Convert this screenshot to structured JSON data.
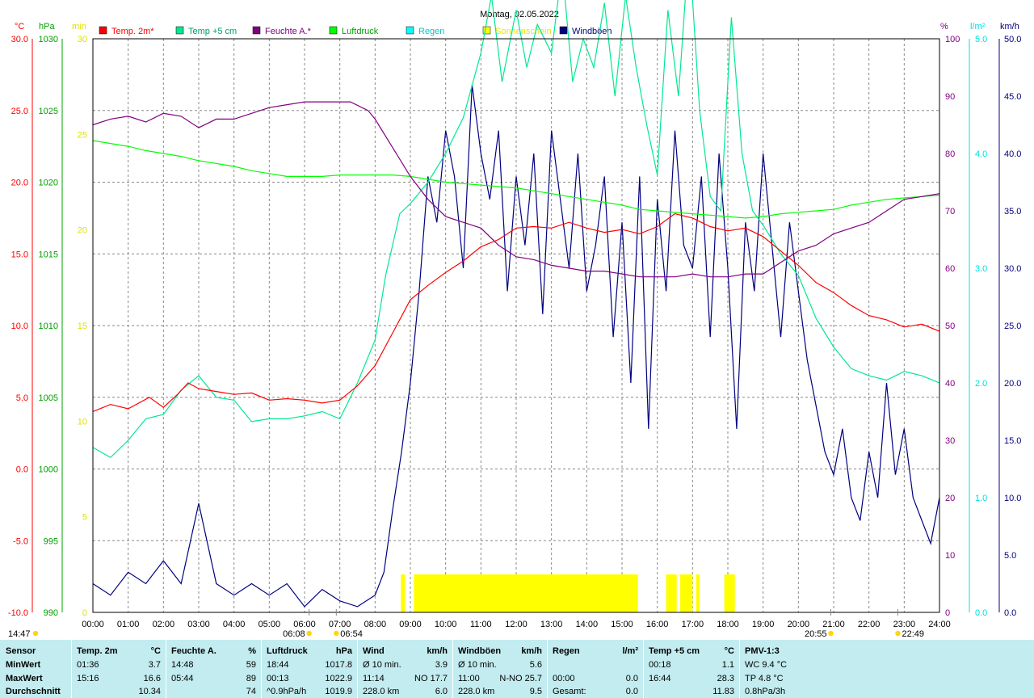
{
  "chart_data": {
    "type": "line",
    "title": "Montag, 02.05.2022",
    "x_ticks": [
      "00:00",
      "01:00",
      "02:00",
      "03:00",
      "04:00",
      "05:00",
      "06:00",
      "07:00",
      "08:00",
      "09:00",
      "10:00",
      "11:00",
      "12:00",
      "13:00",
      "14:00",
      "15:00",
      "16:00",
      "17:00",
      "18:00",
      "19:00",
      "20:00",
      "21:00",
      "22:00",
      "23:00",
      "24:00"
    ],
    "axes": {
      "temp": {
        "unit": "°C",
        "color": "#ff0000",
        "ticks": [
          "30.0",
          "25.0",
          "20.0",
          "15.0",
          "10.0",
          "5.0",
          "0.0",
          "-5.0",
          "-10.0"
        ],
        "ylim": [
          -10,
          30
        ]
      },
      "pressure": {
        "unit": "hPa",
        "color": "#00a000",
        "ticks": [
          "1030",
          "1025",
          "1020",
          "1015",
          "1010",
          "1005",
          "1000",
          "995",
          "990"
        ],
        "ylim": [
          990,
          1030
        ]
      },
      "minutes": {
        "unit": "min",
        "color": "#e0e000",
        "ticks": [
          "30",
          "25",
          "20",
          "15",
          "10",
          "5",
          "0"
        ],
        "ylim": [
          0,
          30
        ]
      },
      "humidity": {
        "unit": "%",
        "color": "#800080",
        "ticks": [
          "100",
          "90",
          "80",
          "70",
          "60",
          "50",
          "40",
          "30",
          "20",
          "10",
          "0"
        ],
        "ylim": [
          0,
          100
        ]
      },
      "rain": {
        "unit": "l/m²",
        "color": "#00e0e0",
        "ticks": [
          "5.0",
          "4.0",
          "3.0",
          "2.0",
          "1.0",
          "0.0"
        ],
        "ylim": [
          0,
          5
        ]
      },
      "wind": {
        "unit": "km/h",
        "color": "#000080",
        "ticks": [
          "50.0",
          "45.0",
          "40.0",
          "35.0",
          "30.0",
          "25.0",
          "20.0",
          "15.0",
          "10.0",
          "5.0",
          "0.0"
        ],
        "ylim": [
          0,
          50
        ]
      }
    },
    "legend": [
      {
        "label": "Temp. 2m*",
        "color": "#ff0000",
        "text_color": "#ff0000"
      },
      {
        "label": "Temp +5 cm",
        "color": "#00e890",
        "text_color": "#00a060"
      },
      {
        "label": "Feuchte A.*",
        "color": "#800080",
        "text_color": "#800080"
      },
      {
        "label": "Luftdruck",
        "color": "#00ff00",
        "text_color": "#00a000"
      },
      {
        "label": "Regen",
        "color": "#00ffff",
        "text_color": "#00c8c8"
      },
      {
        "label": "Sonnenschein",
        "color": "#ffff00",
        "text_color": "#e8e800"
      },
      {
        "label": "Windböen",
        "color": "#000080",
        "text_color": "#000080"
      }
    ],
    "series": [
      {
        "name": "Temp. 2m*",
        "axis": "temp",
        "color": "#ff0000",
        "x": [
          0,
          0.5,
          1,
          1.6,
          2,
          2.4,
          2.7,
          3,
          3.5,
          4,
          4.5,
          5,
          5.5,
          6,
          6.5,
          7,
          7.5,
          8,
          8.5,
          9,
          9.5,
          10,
          10.5,
          11,
          11.5,
          12,
          12.5,
          13,
          13.5,
          14,
          14.5,
          15,
          15.5,
          16,
          16.5,
          17,
          17.5,
          18,
          18.5,
          19,
          19.5,
          20,
          20.5,
          21,
          21.5,
          22,
          22.5,
          23,
          23.5,
          24
        ],
        "y": [
          4.0,
          4.5,
          4.2,
          5.0,
          4.3,
          5.2,
          6.0,
          5.6,
          5.4,
          5.2,
          5.3,
          4.8,
          4.9,
          4.8,
          4.6,
          4.8,
          5.8,
          7.2,
          9.5,
          11.8,
          12.8,
          13.7,
          14.5,
          15.5,
          16.0,
          16.8,
          16.9,
          16.8,
          17.2,
          16.8,
          16.5,
          16.7,
          16.4,
          16.9,
          17.8,
          17.5,
          16.9,
          16.6,
          16.8,
          16.2,
          15.2,
          14.2,
          13.0,
          12.3,
          11.4,
          10.7,
          10.4,
          9.9,
          10.1,
          9.6
        ]
      },
      {
        "name": "Temp +5 cm",
        "axis": "temp",
        "color": "#00e890",
        "x": [
          0,
          0.5,
          1,
          1.5,
          2,
          2.5,
          3,
          3.5,
          4,
          4.5,
          5,
          5.5,
          6,
          6.5,
          7,
          7.5,
          8,
          8.3,
          8.7,
          9,
          9.5,
          10,
          10.5,
          11,
          11.3,
          11.6,
          12,
          12.3,
          12.6,
          13,
          13.3,
          13.6,
          13.9,
          14.2,
          14.5,
          14.8,
          15.1,
          15.4,
          15.7,
          16,
          16.3,
          16.6,
          16.9,
          17.2,
          17.5,
          17.8,
          18.1,
          18.4,
          18.7,
          19,
          19.5,
          20,
          20.5,
          21,
          21.5,
          22,
          22.5,
          23,
          23.5,
          24
        ],
        "y": [
          1.5,
          0.8,
          2.0,
          3.5,
          3.8,
          5.5,
          6.5,
          5.0,
          4.8,
          3.3,
          3.5,
          3.5,
          3.7,
          4.0,
          3.5,
          6.0,
          9.0,
          13.5,
          17.8,
          18.5,
          20.0,
          22.0,
          24.5,
          29.0,
          33.0,
          27.0,
          32.0,
          28.0,
          31.0,
          29.0,
          35.0,
          27.0,
          30.0,
          28.0,
          32.5,
          26.0,
          33.0,
          28.0,
          24.0,
          20.5,
          32.0,
          26.0,
          36.5,
          25.0,
          19.0,
          18.0,
          31.5,
          22.0,
          18.0,
          17.0,
          15.0,
          13.5,
          10.5,
          8.5,
          7.0,
          6.5,
          6.2,
          6.8,
          6.5,
          6.0
        ]
      },
      {
        "name": "Feuchte A.*",
        "axis": "humidity",
        "color": "#800080",
        "x": [
          0,
          0.5,
          1,
          1.5,
          2,
          2.5,
          3,
          3.5,
          4,
          4.5,
          5,
          5.5,
          6,
          6.5,
          7,
          7.3,
          7.8,
          8,
          8.5,
          9,
          9.5,
          10,
          10.5,
          11,
          11.5,
          12,
          12.5,
          13,
          13.5,
          14,
          14.5,
          15,
          15.5,
          16,
          16.5,
          17,
          17.5,
          18,
          18.5,
          19,
          19.5,
          20,
          20.5,
          21,
          21.5,
          22,
          22.5,
          23,
          23.5,
          24
        ],
        "y": [
          85,
          86,
          86.5,
          85.5,
          87,
          86.5,
          84.5,
          86,
          86,
          87,
          88,
          88.5,
          89,
          89,
          89,
          89,
          87.5,
          86,
          81,
          76,
          72,
          69,
          68,
          67,
          64,
          62,
          61.5,
          60.5,
          60,
          59.5,
          59.5,
          59,
          58.5,
          58.5,
          58.5,
          59,
          58.5,
          58.5,
          59,
          59,
          61,
          63,
          64,
          66,
          67,
          68,
          70,
          72,
          72.5,
          73
        ]
      },
      {
        "name": "Luftdruck",
        "axis": "pressure",
        "color": "#00ff00",
        "x": [
          0,
          0.5,
          1,
          1.5,
          2,
          2.5,
          3,
          3.5,
          4,
          4.5,
          5,
          5.5,
          6,
          6.5,
          7,
          7.5,
          8,
          8.5,
          9,
          9.5,
          10,
          10.5,
          11,
          11.5,
          12,
          12.5,
          13,
          13.5,
          14,
          14.5,
          15,
          15.5,
          16,
          16.5,
          17,
          17.5,
          18,
          18.5,
          19,
          19.5,
          20,
          20.5,
          21,
          21.5,
          22,
          22.5,
          23,
          23.5,
          24
        ],
        "y": [
          1022.9,
          1022.7,
          1022.5,
          1022.2,
          1022.0,
          1021.8,
          1021.5,
          1021.3,
          1021.1,
          1020.8,
          1020.6,
          1020.4,
          1020.4,
          1020.4,
          1020.5,
          1020.5,
          1020.5,
          1020.5,
          1020.4,
          1020.2,
          1020.0,
          1019.9,
          1019.8,
          1019.7,
          1019.6,
          1019.4,
          1019.2,
          1019.0,
          1018.8,
          1018.6,
          1018.4,
          1018.1,
          1018.0,
          1017.9,
          1017.8,
          1017.7,
          1017.6,
          1017.5,
          1017.6,
          1017.8,
          1017.9,
          1018.0,
          1018.1,
          1018.4,
          1018.6,
          1018.8,
          1018.9,
          1019.0,
          1019.1
        ]
      },
      {
        "name": "Windböen",
        "axis": "wind",
        "color": "#000080",
        "x": [
          0,
          0.5,
          1,
          1.5,
          2,
          2.5,
          3,
          3.5,
          4,
          4.5,
          5,
          5.5,
          6,
          6.5,
          7,
          7.5,
          8,
          8.25,
          8.5,
          8.75,
          9,
          9.25,
          9.5,
          9.75,
          10,
          10.25,
          10.5,
          10.75,
          11,
          11.25,
          11.5,
          11.75,
          12,
          12.25,
          12.5,
          12.75,
          13,
          13.25,
          13.5,
          13.75,
          14,
          14.25,
          14.5,
          14.75,
          15,
          15.25,
          15.5,
          15.75,
          16,
          16.25,
          16.5,
          16.75,
          17,
          17.25,
          17.5,
          17.75,
          18,
          18.25,
          18.5,
          18.75,
          19,
          19.25,
          19.5,
          19.75,
          20,
          20.25,
          20.5,
          20.75,
          21,
          21.25,
          21.5,
          21.75,
          22,
          22.25,
          22.5,
          22.75,
          23,
          23.25,
          23.5,
          23.75,
          24
        ],
        "y": [
          2.5,
          1.5,
          3.5,
          2.5,
          4.5,
          2.5,
          9.5,
          2.5,
          1.5,
          2.5,
          1.5,
          2.5,
          0.5,
          2.0,
          1.0,
          0.5,
          1.5,
          3.5,
          9.0,
          14.0,
          20.0,
          28.0,
          38.0,
          34.0,
          42.0,
          38.0,
          30.0,
          46.0,
          40.0,
          36.0,
          42.0,
          28.0,
          38.0,
          32.0,
          40.0,
          26.0,
          42.0,
          36.0,
          30.0,
          40.0,
          28.0,
          32.0,
          38.0,
          24.0,
          34.0,
          20.0,
          38.0,
          16.0,
          36.0,
          28.0,
          42.0,
          32.0,
          30.0,
          38.0,
          24.0,
          40.0,
          30.0,
          16.0,
          34.0,
          28.0,
          40.0,
          32.0,
          24.0,
          34.0,
          28.0,
          22.0,
          18.0,
          14.0,
          12.0,
          16.0,
          10.0,
          8.0,
          14.0,
          10.0,
          20.0,
          12.0,
          16.0,
          10.0,
          8.0,
          6.0,
          10.0
        ]
      }
    ],
    "sunshine_blocks": [
      [
        8.73,
        8.85
      ],
      [
        9.1,
        15.45
      ],
      [
        16.25,
        16.55
      ],
      [
        16.65,
        17.0
      ],
      [
        17.1,
        17.2
      ],
      [
        17.9,
        18.2
      ]
    ],
    "markers": [
      {
        "label": "06:08",
        "x": 6.13
      },
      {
        "label": "06:54",
        "x": 6.9
      },
      {
        "label": "20:55",
        "x": 20.92
      },
      {
        "label": "22:49",
        "x": 22.82
      }
    ],
    "corner_label": "14:47"
  },
  "stats": {
    "columns": [
      {
        "header": "Sensor",
        "unit": "",
        "rows": [
          {
            "label": "MinWert",
            "time": "",
            "value": ""
          },
          {
            "label": "MaxWert",
            "time": "",
            "value": ""
          },
          {
            "label": "Durchschnitt",
            "time": "",
            "value": ""
          }
        ]
      },
      {
        "header": "Temp. 2m",
        "unit": "°C",
        "rows": [
          {
            "time": "01:36",
            "value": "3.7"
          },
          {
            "time": "15:16",
            "value": "16.6"
          },
          {
            "time": "",
            "value": "10.34"
          }
        ]
      },
      {
        "header": "Feuchte A.",
        "unit": "%",
        "rows": [
          {
            "time": "14:48",
            "value": "59"
          },
          {
            "time": "05:44",
            "value": "89"
          },
          {
            "time": "",
            "value": "74"
          }
        ]
      },
      {
        "header": "Luftdruck",
        "unit": "hPa",
        "rows": [
          {
            "time": "18:44",
            "value": "1017.8"
          },
          {
            "time": "00:13",
            "value": "1022.9"
          },
          {
            "time": "^0.9hPa/h",
            "value": "1019.9"
          }
        ]
      },
      {
        "header": "Wind",
        "unit": "km/h",
        "rows": [
          {
            "time": "Ø 10 min.",
            "value": "3.9"
          },
          {
            "time": "11:14",
            "value": "NO 17.7"
          },
          {
            "time": "228.0 km",
            "value": "6.0"
          }
        ]
      },
      {
        "header": "Windböen",
        "unit": "km/h",
        "rows": [
          {
            "time": "Ø 10 min.",
            "value": "5.6"
          },
          {
            "time": "11:00",
            "value": "N-NO 25.7"
          },
          {
            "time": "228.0 km",
            "value": "9.5"
          }
        ]
      },
      {
        "header": "Regen",
        "unit": "l/m²",
        "rows": [
          {
            "time": "",
            "value": ""
          },
          {
            "time": "00:00",
            "value": "0.0"
          },
          {
            "time": "Gesamt:",
            "value": "0.0"
          }
        ]
      },
      {
        "header": "Temp +5 cm",
        "unit": "°C",
        "rows": [
          {
            "time": "00:18",
            "value": "1.1"
          },
          {
            "time": "16:44",
            "value": "28.3"
          },
          {
            "time": "",
            "value": "11.83"
          }
        ]
      },
      {
        "header": "PMV-1:3",
        "unit": "",
        "rows": [
          {
            "time": "WC 9.4 °C",
            "value": ""
          },
          {
            "time": "TP 4.8 °C",
            "value": ""
          },
          {
            "time": "0.8hPa/3h",
            "value": ""
          }
        ]
      }
    ]
  }
}
